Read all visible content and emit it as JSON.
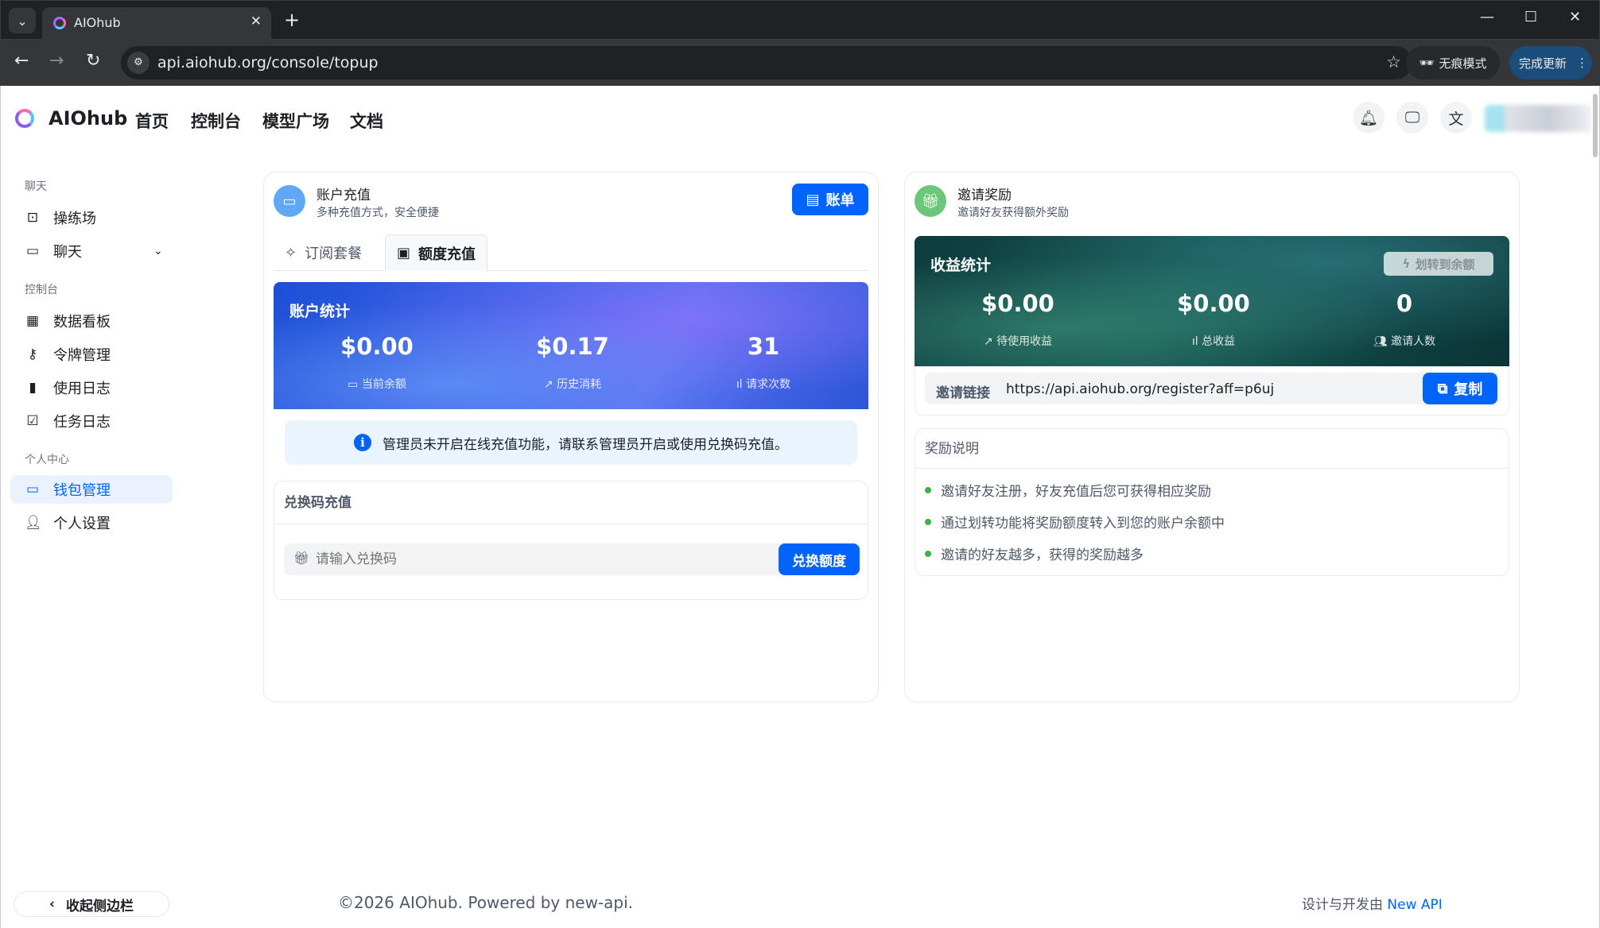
{
  "browser": {
    "tab_title": "AIOhub",
    "url": "api.aiohub.org/console/topup",
    "incognito_label": "无痕模式",
    "update_label": "完成更新"
  },
  "header": {
    "brand": "AIOhub",
    "nav": [
      "首页",
      "控制台",
      "模型广场",
      "文档"
    ]
  },
  "sidebar": {
    "groups": {
      "chat": "聊天",
      "console": "控制台",
      "personal": "个人中心"
    },
    "items": {
      "playground": "操练场",
      "chat": "聊天",
      "dashboard": "数据看板",
      "tokens": "令牌管理",
      "usage_log": "使用日志",
      "task_log": "任务日志",
      "wallet": "钱包管理",
      "settings": "个人设置"
    },
    "collapse": "收起侧边栏"
  },
  "topup": {
    "title": "账户充值",
    "subtitle": "多种充值方式，安全便捷",
    "bill_button": "账单",
    "tabs": [
      "订阅套餐",
      "额度充值"
    ],
    "stats_title": "账户统计",
    "stats": [
      {
        "value": "$0.00",
        "label": "当前余额"
      },
      {
        "value": "$0.17",
        "label": "历史消耗"
      },
      {
        "value": "31",
        "label": "请求次数"
      }
    ],
    "notice": "管理员未开启在线充值功能，请联系管理员开启或使用兑换码充值。",
    "redeem_title": "兑换码充值",
    "redeem_placeholder": "请输入兑换码",
    "redeem_button": "兑换额度"
  },
  "invite": {
    "title": "邀请奖励",
    "subtitle": "邀请好友获得额外奖励",
    "stats_title": "收益统计",
    "transfer_button": "划转到余额",
    "stats": [
      {
        "value": "$0.00",
        "label": "待使用收益"
      },
      {
        "value": "$0.00",
        "label": "总收益"
      },
      {
        "value": "0",
        "label": "邀请人数"
      }
    ],
    "link_label": "邀请链接",
    "link": "https://api.aiohub.org/register?aff=p6uj",
    "copy_button": "复制",
    "rules_title": "奖励说明",
    "rules": [
      "邀请好友注册，好友充值后您可获得相应奖励",
      "通过划转功能将奖励额度转入到您的账户余额中",
      "邀请的好友越多，获得的奖励越多"
    ]
  },
  "footer": {
    "copyright": "©2026 AIOhub. Powered by new-api.",
    "designed_prefix": "设计与开发由",
    "designed_link": "New API"
  },
  "colors": {
    "accent": "#0064fa",
    "bullet": "#3bb346"
  }
}
